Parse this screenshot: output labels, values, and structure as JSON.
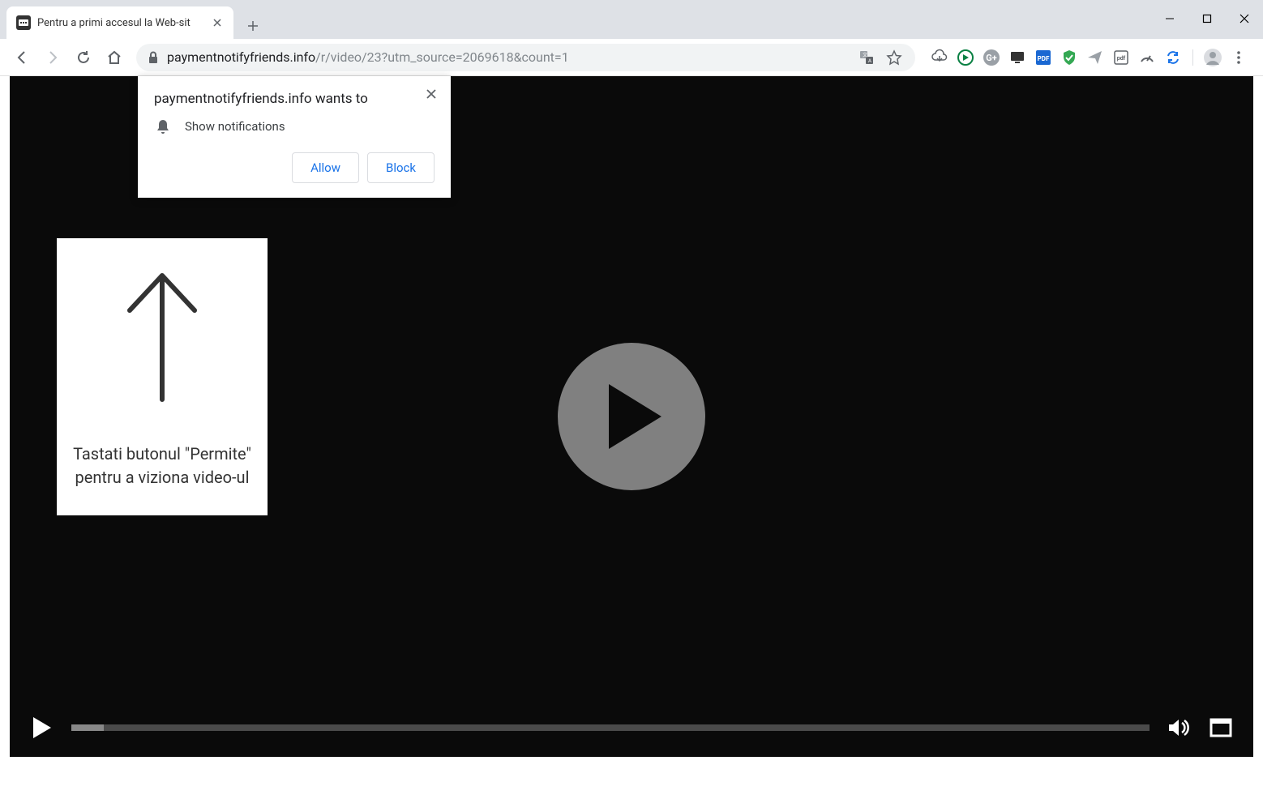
{
  "tab": {
    "title": "Pentru a primi accesul la Web-sit"
  },
  "url": {
    "domain": "paymentnotifyfriends.info",
    "path": "/r/video/23?utm_source=2069618&count=1"
  },
  "notification": {
    "title": "paymentnotifyfriends.info wants to",
    "description": "Show notifications",
    "allow": "Allow",
    "block": "Block"
  },
  "hint": {
    "text": "Tastati butonul \"Permite\" pentru a viziona video-ul"
  },
  "video": {
    "progress_percent": 3
  }
}
